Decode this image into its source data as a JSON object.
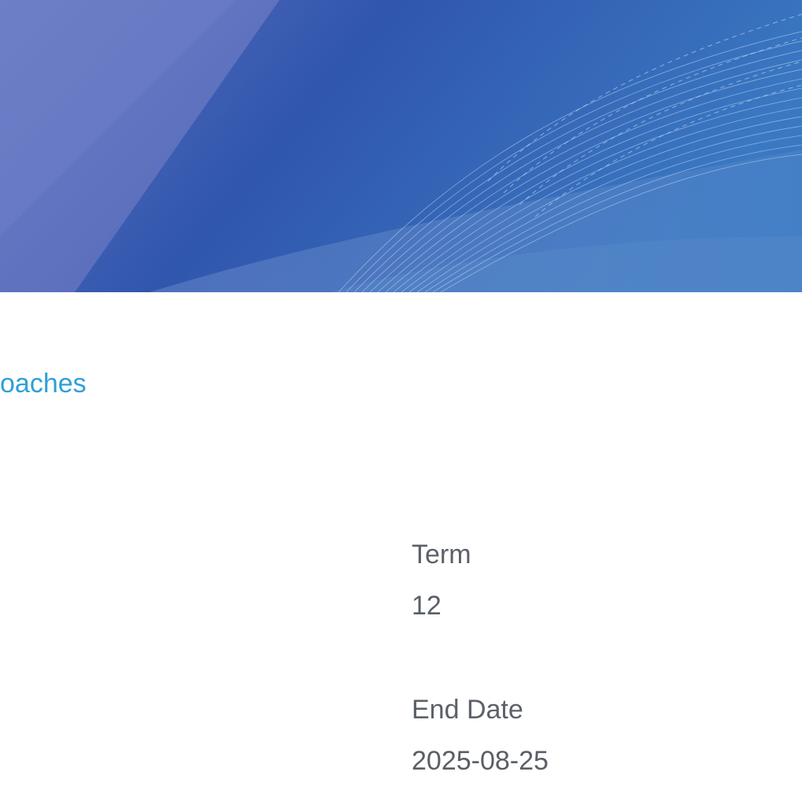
{
  "header": {
    "title": "oaches"
  },
  "details": {
    "term": {
      "label": "Term",
      "value": "12"
    },
    "end_date": {
      "label": "End Date",
      "value": "2025-08-25"
    }
  },
  "colors": {
    "banner_left": "#5b6fbd",
    "banner_mid": "#2f58ae",
    "banner_right": "#3f7cc4",
    "title_accent": "#2ea0d6",
    "label_text": "#5c6169",
    "value_text": "#5a5f66"
  }
}
